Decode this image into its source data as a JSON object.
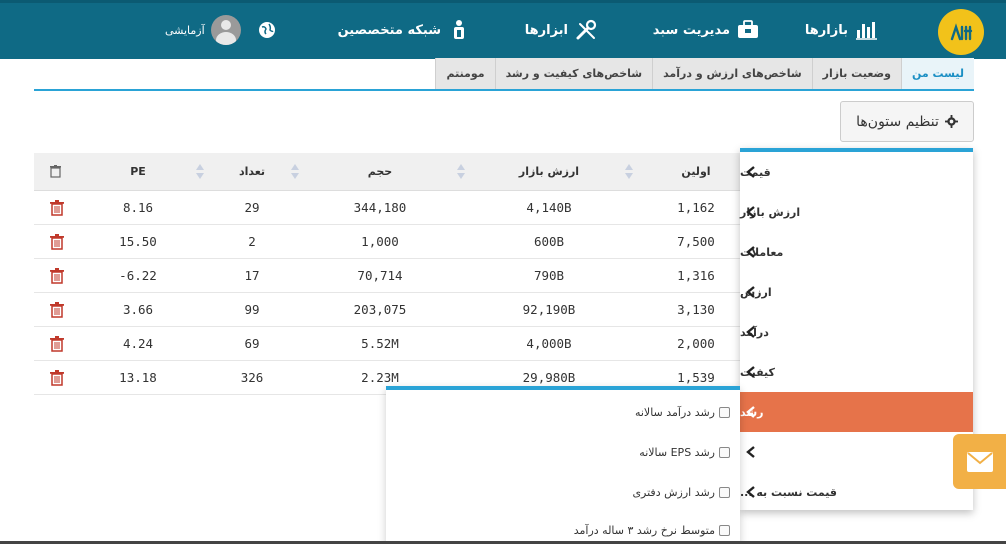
{
  "navbar": {
    "markets_label": "بازارها",
    "basket_label": "مدیریت سبد",
    "tools_label": "ابزارها",
    "experts_label": "شبکه متخصصین",
    "user_name": "آزمایشی",
    "icons": [
      "logo",
      "bar-chart-icon",
      "briefcase-icon",
      "tools-icon",
      "network-icon",
      "globe-icon",
      "avatar"
    ]
  },
  "tabs": [
    {
      "label": "لیست من",
      "active": true
    },
    {
      "label": "وضعیت بازار"
    },
    {
      "label": "شاخص‌های ارزش و درآمد"
    },
    {
      "label": "شاخص‌های کیفیت و رشد"
    },
    {
      "label": "مومنتم"
    }
  ],
  "column_settings_label": "تنظیم ستون‌ها",
  "table": {
    "headers": {
      "pe": "PE",
      "count": "تعداد",
      "volume": "حجم",
      "market_cap": "ارزش بازار",
      "first": "اولین"
    },
    "rows": [
      {
        "pe": "8.16",
        "count": "29",
        "volume": "344,180",
        "market_cap": "4,140B",
        "first": "1,162"
      },
      {
        "pe": "15.50",
        "count": "2",
        "volume": "1,000",
        "market_cap": "600B",
        "first": "7,500"
      },
      {
        "pe": "-6.22",
        "count": "17",
        "volume": "70,714",
        "market_cap": "790B",
        "first": "1,316"
      },
      {
        "pe": "3.66",
        "count": "99",
        "volume": "203,075",
        "market_cap": "92,190B",
        "first": "3,130"
      },
      {
        "pe": "4.24",
        "count": "69",
        "volume": "5.52M",
        "market_cap": "4,000B",
        "first": "2,000"
      },
      {
        "pe": "13.18",
        "count": "326",
        "volume": "2.23M",
        "market_cap": "29,980B",
        "first": "1,539"
      }
    ]
  },
  "menu": {
    "items": [
      "قیمت",
      "ارزش بازار",
      "معاملات",
      "ارزش",
      "درآمد",
      "کیفیت",
      "رشد",
      "",
      "قیمت نسبت به ..."
    ],
    "active_index": 6
  },
  "submenu": {
    "items": [
      "رشد درآمد سالانه",
      "رشد EPS سالانه",
      "رشد ارزش دفتری",
      "متوسط نرخ رشد ۳ ساله درآمد"
    ]
  },
  "colors": {
    "navbar": "#0f6a85",
    "accent": "#2aa3d6",
    "active_menu": "#e6734a",
    "mail_button": "#f2b046",
    "logo": "#f2c21a",
    "trash": "#c0392b"
  }
}
